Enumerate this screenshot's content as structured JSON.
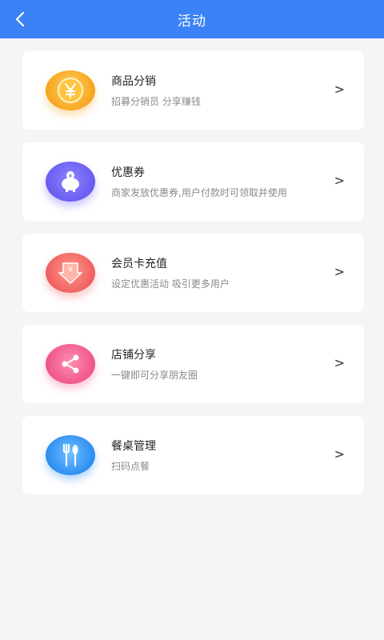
{
  "header": {
    "title": "活动",
    "back_icon": "chevron-left-icon"
  },
  "items": [
    {
      "title": "商品分销",
      "desc": "招募分销员 分享赚钱",
      "arrow": ">",
      "icon": "yen-coin-icon",
      "color": "#f7a51e"
    },
    {
      "title": "优惠券",
      "desc": "商家发放优惠券,用户付款时可领取并使用",
      "arrow": ">",
      "icon": "piggy-bank-icon",
      "color": "#6a5cf0"
    },
    {
      "title": "会员卡充值",
      "desc": "设定优惠活动 吸引更多用户",
      "arrow": ">",
      "icon": "recharge-icon",
      "color": "#f06060"
    },
    {
      "title": "店铺分享",
      "desc": "一键即可分享朋友圈",
      "arrow": ">",
      "icon": "share-icon",
      "color": "#f0558a"
    },
    {
      "title": "餐桌管理",
      "desc": "扫码点餐",
      "arrow": ">",
      "icon": "cutlery-icon",
      "color": "#2e8df2"
    }
  ]
}
